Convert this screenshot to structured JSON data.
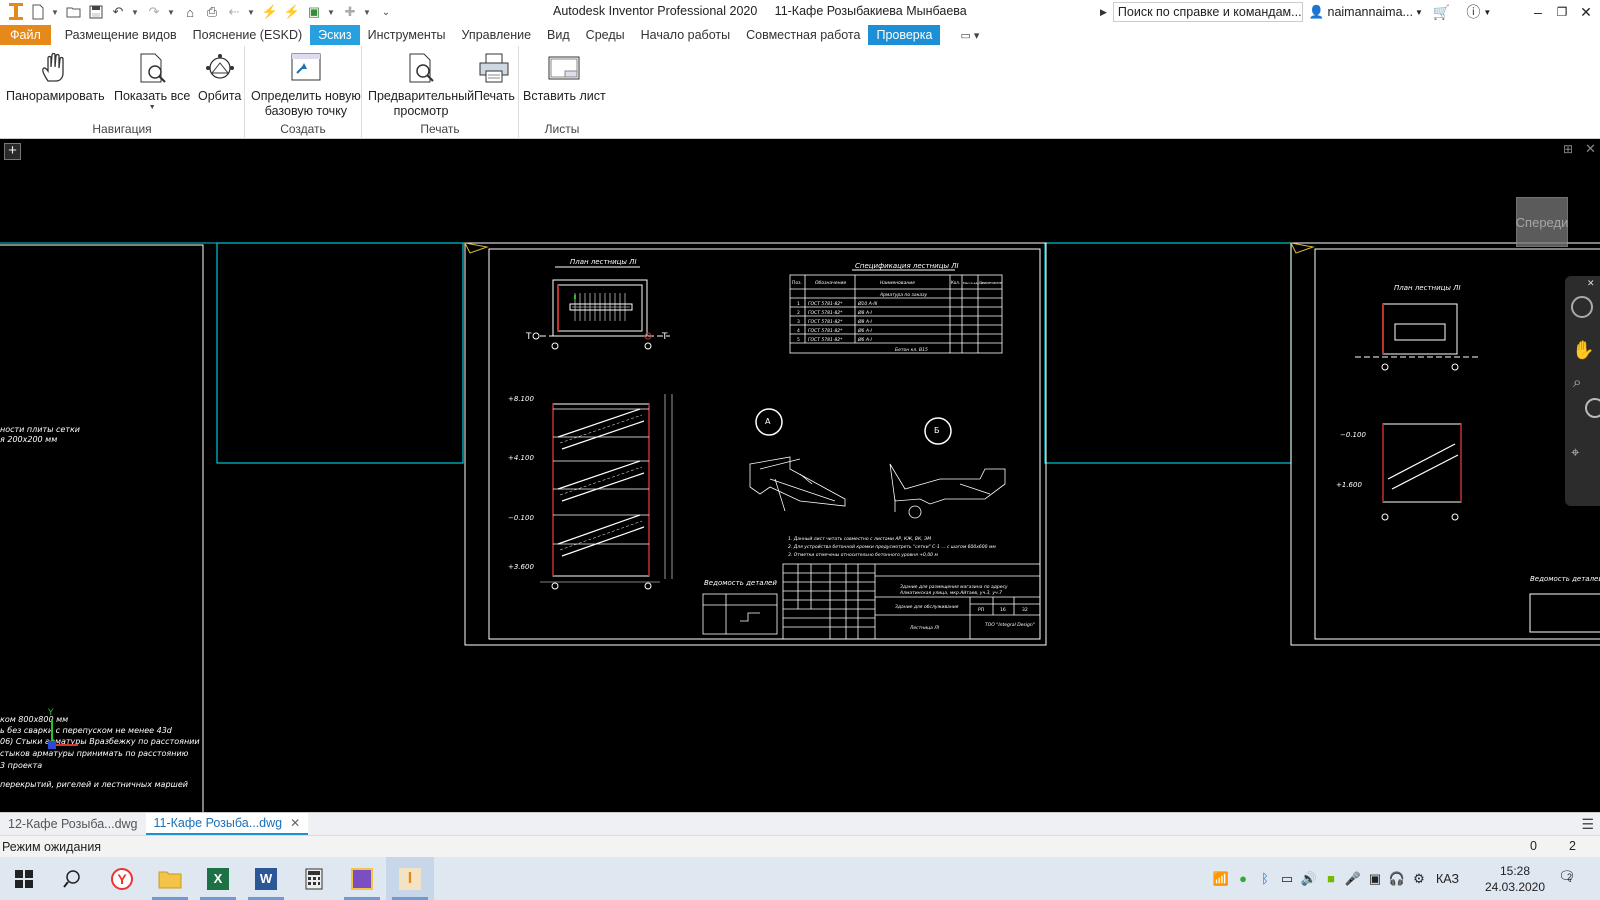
{
  "titlebar": {
    "app_title": "Autodesk Inventor Professional 2020",
    "doc_title": "11-Кафе Розыбакиева Мынбаева",
    "search_placeholder": "Поиск по справке и командам...",
    "user": "naimannaima..."
  },
  "menu": {
    "tabs": [
      "Файл",
      "Размещение видов",
      "Пояснение (ESKD)",
      "Эскиз",
      "Инструменты",
      "Управление",
      "Вид",
      "Среды",
      "Начало работы",
      "Совместная работа",
      "Проверка"
    ]
  },
  "ribbon": {
    "groups": {
      "nav": "Навигация",
      "create": "Создать",
      "print": "Печать",
      "sheets": "Листы"
    },
    "buttons": {
      "pan": "Панорамировать",
      "zoom_all": "Показать все",
      "orbit": "Орбита",
      "base_point_1": "Определить новую",
      "base_point_2": "базовую точку",
      "preview_1": "Предварительный",
      "preview_2": "просмотр",
      "print": "Печать",
      "insert_sheet": "Вставить лист"
    }
  },
  "canvas": {
    "viewcube_label": "Спереди",
    "left_sheet_notes": [
      "ности плиты сетки",
      "я 200х200 мм",
      "ком 800х800 мм",
      "ь без сварки с перепуском не менее 43d",
      "06) Стыки арматуры Вразбежку по расстоянии",
      "стыков арматуры принимать по расстоянию",
      "3 проекта",
      "перекрытий, ригелей и лестничных маршей"
    ],
    "main_sheet": {
      "plan_title": "План лестницы ЛI",
      "spec_title": "Спецификация лестницы ЛI",
      "spec_headers": [
        "Поз.",
        "Обозначение",
        "Наименование",
        "Кол.",
        "Масса ед., кг",
        "Примечание"
      ],
      "spec_rows": [
        [
          "",
          "",
          "Арматура по заказу",
          "",
          "",
          ""
        ],
        [
          "1",
          "ГОСТ 5781-82*",
          "Ø10 A-III",
          "",
          "",
          ""
        ],
        [
          "2",
          "ГОСТ 5781-82*",
          "Ø8 A-I",
          "",
          "",
          ""
        ],
        [
          "3",
          "ГОСТ 5781-82*",
          "Ø8 A-I",
          "",
          "",
          ""
        ],
        [
          "4",
          "ГОСТ 5781-82*",
          "Ø6 A-I",
          "",
          "",
          ""
        ],
        [
          "5",
          "ГОСТ 5781-82*",
          "Ø6 A-I",
          "",
          "",
          ""
        ]
      ],
      "spec_total": "Бетон кл. В15",
      "elevations": [
        "+8.100",
        "+4.100",
        "−0.100",
        "+3.600"
      ],
      "section_a": "А",
      "section_b": "Б",
      "notes": [
        "1. Данный лист читать совместно с листами АР, КЖ, ВК, ЭМ",
        "2. Для устройства бетонной кромки предусмотреть \"сетки\" С-1 ... с шагом 600х600 мм",
        "3. Отметки отмечены относительно бетонного уровня +0,00 м"
      ],
      "rebar_table_title": "Ведомость деталей",
      "title_block": {
        "project": "Здание для размещения магазина по адресу",
        "project2": "Алматинская улица, мкр.Айтаев, уч.3, уч.7",
        "sheet_name": "Здание для обслуживания",
        "drawing": "Лестница ЛI",
        "company": "ТОО \"Integral Design\"",
        "stage": "РП",
        "sheet": "16",
        "sheets": "32"
      }
    },
    "right_sheet": {
      "plan_title": "План лестницы ЛI",
      "elevations": [
        "−0.100",
        "+1.600"
      ],
      "rebar_table_title": "Ведомость деталей"
    }
  },
  "doc_tabs": {
    "tab1": "12-Кафе Розыба...dwg",
    "tab2": "11-Кафе Розыба...dwg"
  },
  "status": {
    "text": "Режим ожидания",
    "count1": "0",
    "count2": "2"
  },
  "taskbar": {
    "apps": [
      "windows-start",
      "search",
      "yandex-browser",
      "file-explorer",
      "excel",
      "word",
      "calculator",
      "visual-studio",
      "inventor"
    ],
    "lang": "КАЗ",
    "time": "15:28",
    "date": "24.03.2020",
    "notifications": "2"
  },
  "colors": {
    "file_tab": "#e5891a",
    "active_tab": "#1c8fd6",
    "sheet_border": "#00c8d8",
    "drawing_lines": "#ffffff",
    "rebar": "#c23030"
  }
}
